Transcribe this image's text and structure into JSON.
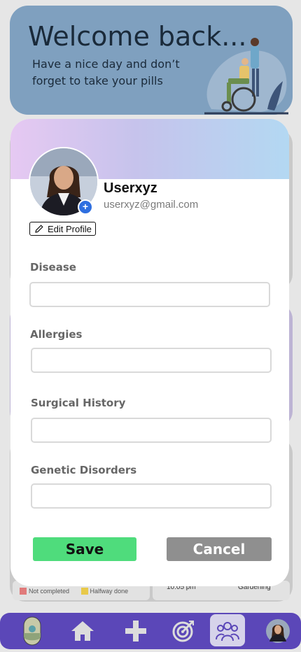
{
  "banner": {
    "title": "Welcome back...",
    "subtitle": "Have a nice day and don’t forget to take your pills"
  },
  "background": {
    "legend": [
      {
        "label": "Not completed",
        "color": "#e07a7a"
      },
      {
        "label": "Halfway done",
        "color": "#e8c94a"
      }
    ],
    "time_text": "10:05 pm",
    "activity_text": "Gardening"
  },
  "profile": {
    "username": "Userxyz",
    "email": "userxyz@gmail.com",
    "edit_label": "Edit Profile"
  },
  "form": {
    "fields": [
      {
        "label": "Disease",
        "value": ""
      },
      {
        "label": "Allergies",
        "value": ""
      },
      {
        "label": "Surgical History",
        "value": ""
      },
      {
        "label": "Genetic Disorders",
        "value": ""
      }
    ],
    "save_label": "Save",
    "cancel_label": "Cancel"
  },
  "colors": {
    "save": "#4fdc7c",
    "cancel": "#8f8f8f",
    "nav": "#5b47b8",
    "accent_plus": "#2f6fe0"
  },
  "nav": {
    "items": [
      "pill-icon",
      "home-icon",
      "plus-icon",
      "target-icon",
      "community-icon",
      "profile-avatar"
    ],
    "active": "community-icon"
  }
}
